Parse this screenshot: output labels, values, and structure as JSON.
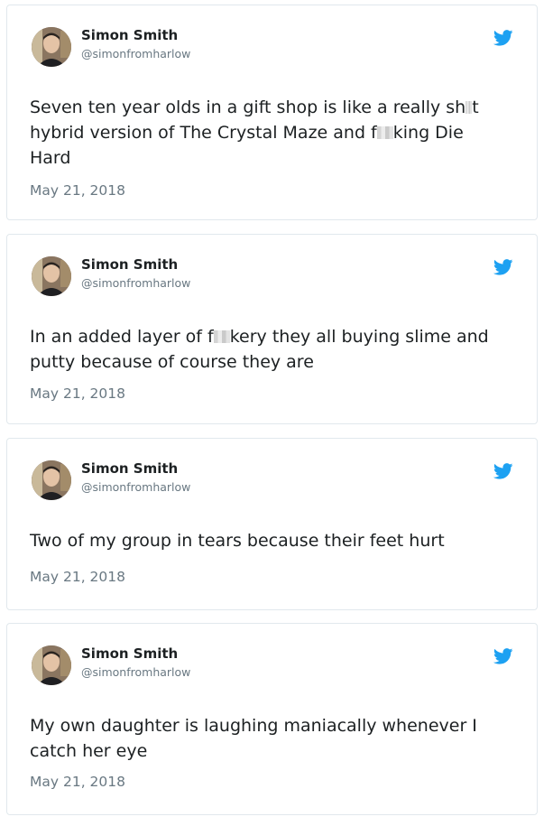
{
  "tweets": [
    {
      "author_name": "Simon Smith",
      "author_handle": "@simonfromharlow",
      "text_parts": [
        "Seven ten year olds in a gift shop is like a really sh",
        "t hybrid version of The Crystal Maze and f",
        "king Die Hard"
      ],
      "date": "May 21, 2018"
    },
    {
      "author_name": "Simon Smith",
      "author_handle": "@simonfromharlow",
      "text_parts": [
        "In an added layer of f",
        "kery they all buying slime and putty because of course they are"
      ],
      "date": "May 21, 2018"
    },
    {
      "author_name": "Simon Smith",
      "author_handle": "@simonfromharlow",
      "text_parts": [
        "Two of my group in tears because their feet hurt"
      ],
      "date": "May 21, 2018"
    },
    {
      "author_name": "Simon Smith",
      "author_handle": "@simonfromharlow",
      "text_parts": [
        "My own daughter is laughing maniacally whenever I catch her eye"
      ],
      "date": "May 21, 2018"
    }
  ],
  "icons": {
    "avatar": "profile-photo",
    "platform": "twitter-bird-icon"
  },
  "colors": {
    "twitter_blue": "#1da1f2",
    "secondary_text": "#697882",
    "border": "#e1e8ed"
  }
}
